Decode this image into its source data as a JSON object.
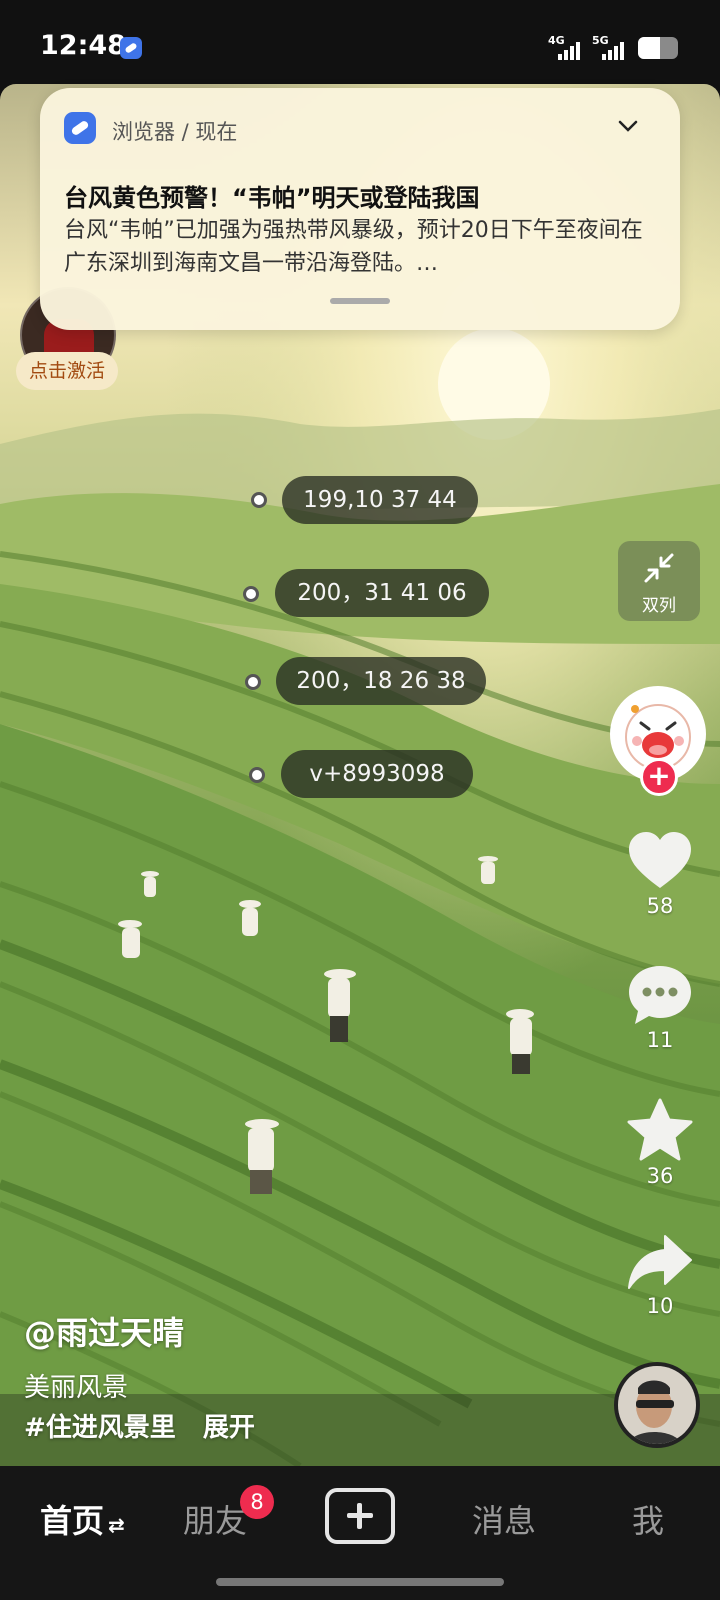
{
  "status_bar": {
    "time": "12:48",
    "signal_1_label": "4G",
    "signal_2_label": "5G",
    "icons": [
      "browser-app-icon",
      "signal-4g-icon",
      "signal-5g-icon",
      "battery-icon"
    ],
    "battery_level": 0.55
  },
  "notification": {
    "source": "浏览器 / 现在",
    "title": "台风黄色预警！“韦帕”明天或登陆我国",
    "body": "台风“韦帕”已加强为强热带风暴级，预计20日下午至夜间在广东深圳到海南文昌一带沿海登陆。…"
  },
  "activate": {
    "badge": "点击激活"
  },
  "annotations": [
    "199,10 37 44",
    "200，31 41 06",
    "200，18 26 38",
    "v+8993098"
  ],
  "sidebar": {
    "dual_column_label": "双列",
    "likes": "58",
    "comments": "11",
    "favorites": "36",
    "shares": "10",
    "follow_symbol": "+"
  },
  "caption": {
    "author": "@雨过天晴",
    "description": "美丽风景",
    "hashtag": "#住进风景里",
    "expand": "展开"
  },
  "bottom_nav": {
    "home": "首页",
    "home_arrow": "⇄",
    "friends": "朋友",
    "friends_badge": "8",
    "messages": "消息",
    "me": "我"
  },
  "colors": {
    "accent_red": "#ee2c4f",
    "notification_bg": "#faf4dc",
    "nav_bg": "#161616"
  }
}
